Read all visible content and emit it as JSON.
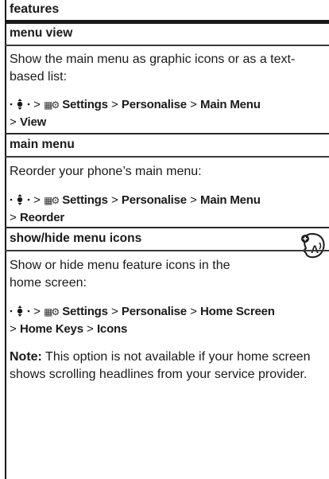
{
  "header": {
    "title": "features"
  },
  "sections": [
    {
      "title": "menu view",
      "description": "Show the main menu as graphic icons or as a text-based list:",
      "path": {
        "sep": ">",
        "settings_icon": "settings-icon",
        "line1": [
          "Settings",
          "Personalise",
          "Main Menu"
        ],
        "line2": [
          "View"
        ]
      }
    },
    {
      "title": "main menu",
      "description": "Reorder your phone’s main menu:",
      "path": {
        "sep": ">",
        "settings_icon": "settings-icon",
        "line1": [
          "Settings",
          "Personalise",
          "Main Menu"
        ],
        "line2": [
          "Reorder"
        ]
      }
    },
    {
      "title": "show/hide menu icons",
      "description": "Show or hide menu feature icons in the home screen:",
      "path": {
        "sep": ">",
        "settings_icon": "settings-icon",
        "line1": [
          "Settings",
          "Personalise",
          "Home Screen"
        ],
        "line2": [
          "Home Keys",
          "Icons"
        ]
      },
      "note_label": "Note:",
      "note_text": " This option is not available if your home screen shows scrolling headlines from your service provider.",
      "corner_icon": "personalise-feature-icon"
    }
  ]
}
